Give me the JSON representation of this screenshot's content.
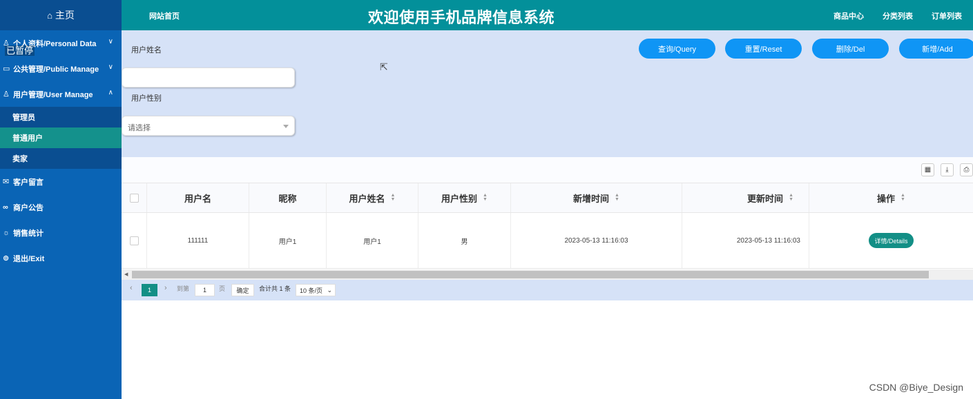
{
  "sidebar": {
    "home": "主页",
    "items": [
      {
        "label": "个人资料/Personal Data",
        "icon": "user-icon"
      },
      {
        "label": "公共管理/Public Manage",
        "icon": "monitor-icon"
      },
      {
        "label": "用户管理/User Manage",
        "icon": "user-icon"
      }
    ],
    "sub_items": [
      "管理员",
      "普通用户",
      "卖家"
    ],
    "bottom_items": [
      {
        "label": "客户留言",
        "icon": "message-icon"
      },
      {
        "label": "商户公告",
        "icon": "link-icon"
      },
      {
        "label": "销售统计",
        "icon": "chart-icon"
      },
      {
        "label": "退出/Exit",
        "icon": "exit-icon"
      }
    ],
    "paused_overlay": "已暂停"
  },
  "topbar": {
    "home_link": "网站首页",
    "title": "欢迎使用手机品牌信息系统",
    "links": [
      "商品中心",
      "分类列表",
      "订单列表"
    ]
  },
  "search": {
    "name_label": "用户姓名",
    "name_value": "",
    "gender_label": "用户性别",
    "gender_placeholder": "请选择",
    "buttons": {
      "query": "查询/Query",
      "reset": "重置/Reset",
      "delete": "删除/Del",
      "add": "新增/Add"
    }
  },
  "table": {
    "headers": [
      "用户名",
      "昵称",
      "用户姓名",
      "用户性别",
      "新增时间",
      "更新时间",
      "操作"
    ],
    "rows": [
      {
        "username": "111111",
        "nickname": "用户1",
        "real_name": "用户1",
        "gender": "男",
        "created": "2023-05-13 11:16:03",
        "updated": "2023-05-13 11:16:03",
        "action": "详情/Details"
      }
    ]
  },
  "pagination": {
    "current_page": "1",
    "goto_label": "到第",
    "goto_value": "1",
    "page_unit": "页",
    "confirm": "确定",
    "total": "合计共 1 条",
    "page_size": "10 条/页"
  },
  "watermark": "CSDN @Biye_Design",
  "colors": {
    "sidebar": "#0a64b5",
    "sidebar_dark": "#0a4e91",
    "topbar": "#03909a",
    "active": "#14918c",
    "button": "#0f95f5",
    "search_bg": "#d6e2f7"
  }
}
